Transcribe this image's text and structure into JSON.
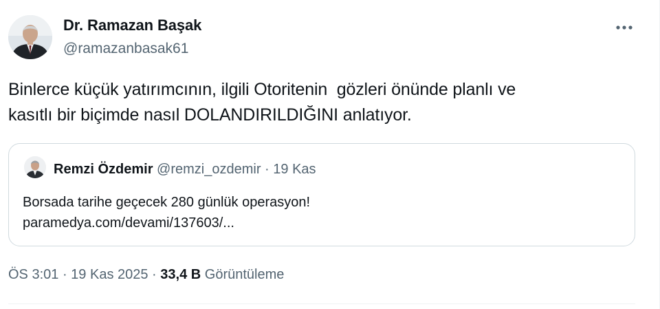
{
  "author": {
    "name": "Dr. Ramazan Başak",
    "handle": "@ramazanbasak61"
  },
  "more_icon": "more-horizontal-icon",
  "tweet": {
    "text": "Binlerce küçük yatırımcının, ilgili Otoritenin  gözleri önünde planlı ve\nkasıtlı bir biçimde nasıl DOLANDIRILDIĞINI anlatıyor."
  },
  "quote": {
    "author_name": "Remzi Özdemir",
    "author_handle": "@remzi_ozdemir",
    "separator": " · ",
    "date": "19 Kas",
    "text_line1": "Borsada tarihe geçecek 280 günlük operasyon!",
    "text_line2": "paramedya.com/devami/137603/..."
  },
  "meta": {
    "time": "ÖS 3:01",
    "separator": " · ",
    "date": "19 Kas 2025",
    "views_count": "33,4 B",
    "views_label": "Görüntüleme"
  },
  "colors": {
    "text_primary": "#0f1419",
    "text_secondary": "#536471",
    "border": "#cfd9de"
  }
}
